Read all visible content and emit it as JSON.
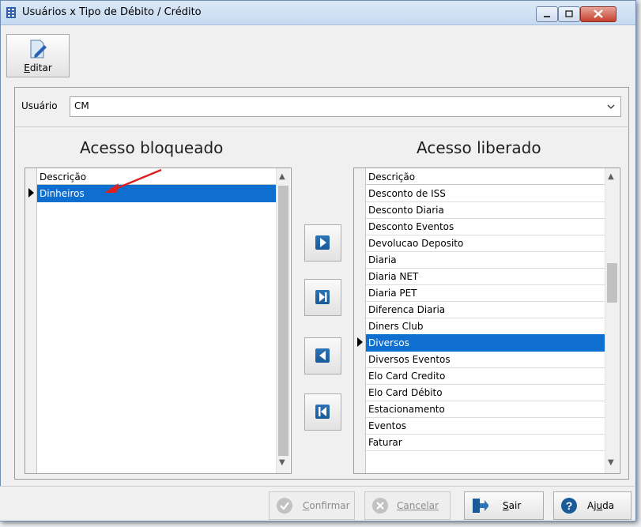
{
  "window": {
    "title": "Usuários x Tipo de Débito / Crédito"
  },
  "toolbar": {
    "edit_label_first": "E",
    "edit_label_rest": "ditar"
  },
  "user": {
    "label": "Usuário",
    "value": "CM"
  },
  "blocked": {
    "heading": "Acesso bloqueado",
    "column": "Descrição",
    "rows": [
      "Dinheiros"
    ],
    "selected_index": 0
  },
  "allowed": {
    "heading": "Acesso liberado",
    "column": "Descrição",
    "rows": [
      "Desconto de ISS",
      "Desconto Diaria",
      "Desconto Eventos",
      "Devolucao Deposito",
      "Diaria",
      "Diaria NET",
      "Diaria PET",
      "Diferenca Diaria",
      "Diners Club",
      "Diversos",
      "Diversos Eventos",
      "Elo Card Credito",
      "Elo Card Débito",
      "Estacionamento",
      "Eventos",
      "Faturar"
    ],
    "selected_index": 9
  },
  "transfer_buttons": [
    "move-right",
    "move-all-right",
    "move-left",
    "move-all-left"
  ],
  "footer": {
    "confirm": {
      "first": "C",
      "rest": "onfirmar"
    },
    "cancel": {
      "first": "C",
      "rest": "ancelar"
    },
    "exit": {
      "first": "S",
      "rest": "air"
    },
    "help_pre": "Aj",
    "help_u": "u",
    "help_post": "da"
  },
  "colors": {
    "selection": "#0f6fd1",
    "accent_blue": "#1a5a98",
    "annotation_arrow": "#e02020"
  }
}
